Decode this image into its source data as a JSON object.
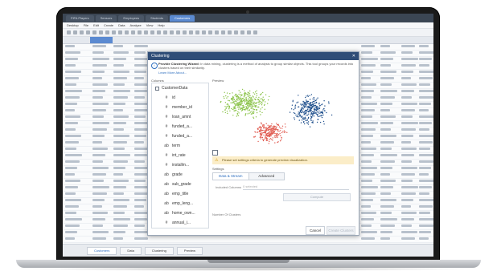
{
  "app": {
    "tabs": [
      "FIFA Players",
      "Sensors",
      "Employees",
      "Students",
      "Customers"
    ],
    "active_tab": 4,
    "menu": [
      "Desktop",
      "File",
      "Edit",
      "Create",
      "Data",
      "Analyze",
      "View",
      "Help"
    ]
  },
  "dialog": {
    "title": "Clustering",
    "close": "✕",
    "info_bold": "Provide Clustering Wizard:",
    "info_text": "In data mining, clustering is a method of analysis to group similar objects. This tool groups your records into clusters based on their similarity.",
    "info_link": "Learn More About...",
    "columns_header": "Columns",
    "preview_header": "Preview",
    "columns": [
      {
        "type": "checkbox",
        "label": "CustomerData"
      },
      {
        "type": "#",
        "label": "id"
      },
      {
        "type": "#",
        "label": "member_id"
      },
      {
        "type": "#",
        "label": "loan_amnt"
      },
      {
        "type": "#",
        "label": "funded_a..."
      },
      {
        "type": "#",
        "label": "funded_a..."
      },
      {
        "type": "ab",
        "label": "term"
      },
      {
        "type": "#",
        "label": "int_rate"
      },
      {
        "type": "#",
        "label": "installm..."
      },
      {
        "type": "ab",
        "label": "grade"
      },
      {
        "type": "ab",
        "label": "sub_grade"
      },
      {
        "type": "ab",
        "label": "emp_title"
      },
      {
        "type": "ab",
        "label": "emp_leng..."
      },
      {
        "type": "ab",
        "label": "home_own..."
      },
      {
        "type": "#",
        "label": "annual_i..."
      }
    ],
    "warning": "Please set settings criteria to generate preview visualization.",
    "settings_label": "Settings",
    "settings_tabs": [
      "Data & Stream",
      "Advanced"
    ],
    "active_settings_tab": 0,
    "field_label": "Included Columns",
    "field_placeholder": "0 selected",
    "compute_label": "Compute",
    "clusters_label": "Number Of Clusters",
    "cancel_label": "Cancel",
    "create_label": "Create Clusters"
  },
  "status": {
    "sheets": [
      "Customers",
      "Data",
      "Clustering",
      "Preview"
    ],
    "active_sheet": 0
  },
  "colors": {
    "cluster_a": "#8bc34a",
    "cluster_b": "#1e4f8c",
    "cluster_c": "#e05a4f",
    "accent": "#2f6fbf",
    "title_bar": "#2f4d77"
  }
}
